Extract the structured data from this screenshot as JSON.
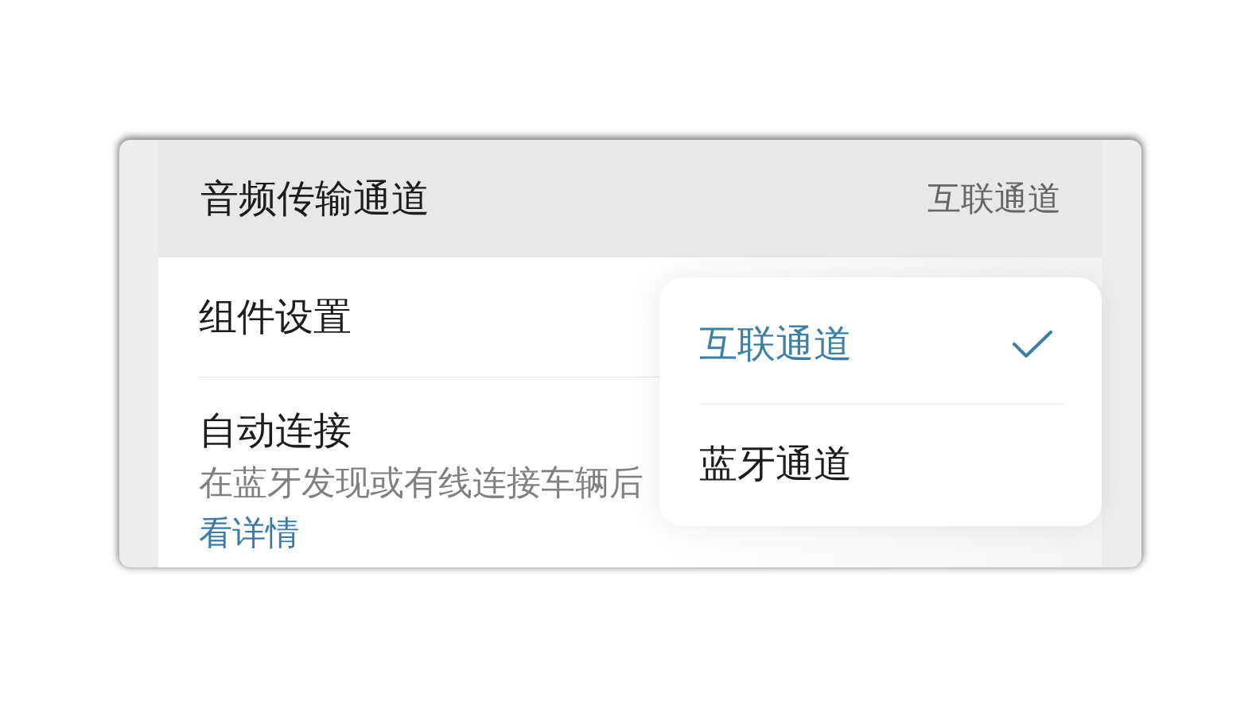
{
  "header": {
    "title": "音频传输通道",
    "value": "互联通道"
  },
  "rows": [
    {
      "kind": "plain",
      "title": "组件设置"
    },
    {
      "kind": "described",
      "title": "自动连接",
      "description": "在蓝牙发现或有线连接车辆后",
      "link": "看详情"
    }
  ],
  "dropdown": {
    "options": [
      {
        "label": "互联通道",
        "selected": true
      },
      {
        "label": "蓝牙通道",
        "selected": false
      }
    ]
  }
}
